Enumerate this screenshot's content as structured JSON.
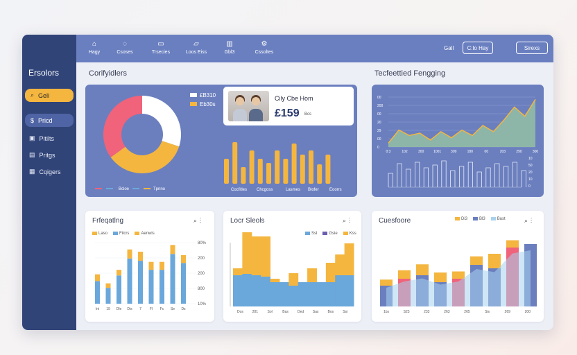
{
  "colors": {
    "navy": "#314478",
    "periwinkle": "#6b7fbf",
    "yellow": "#f4b63f",
    "blue": "#6aa7db",
    "pink": "#f0637a",
    "white": "#ffffff"
  },
  "sidebar": {
    "brand": "Ersolors",
    "primary_button": {
      "label": "Geli",
      "icon": "search-icon"
    },
    "items": [
      {
        "label": "Pricd",
        "icon": "dollar-icon",
        "active": true
      },
      {
        "label": "Pitilts",
        "icon": "box-icon"
      },
      {
        "label": "Pritgs",
        "icon": "tag-icon"
      },
      {
        "label": "Cqigers",
        "icon": "grid-icon"
      }
    ]
  },
  "topbar": {
    "nav": [
      {
        "label": "Hagy",
        "icon": "home-icon"
      },
      {
        "label": "Csoses",
        "icon": "user-icon"
      },
      {
        "label": "Trsecies",
        "icon": "doc-icon"
      },
      {
        "label": "Loos Eiss",
        "icon": "folder-icon"
      },
      {
        "label": "Gbl3",
        "icon": "chart-icon"
      },
      {
        "label": "Cssoltes",
        "icon": "settings-icon"
      }
    ],
    "right_text": "Gall",
    "button1": "C:lo Hay",
    "button2": "Sirexs",
    "icon_right": "chevron-up-icon"
  },
  "section1_title": "Corifyidlers",
  "section2_title": "Tecfeettied Fengging",
  "donut_panel": {
    "legend": [
      {
        "label": "£B310",
        "color": "#ffffff"
      },
      {
        "label": "Eb30s",
        "color": "#f4b63f"
      }
    ],
    "bottom_legend": [
      "Bcloe",
      "Tpnno"
    ]
  },
  "profile": {
    "name": "Cily Cbe Hom",
    "amount": "£159",
    "unit": "Bcs"
  },
  "bars_labels": [
    "Cocfitles",
    "Chcgoss",
    "Lasmes",
    "Blofer",
    "Eoorrs"
  ],
  "card1": {
    "title": "Frfeqatlng",
    "legend": [
      {
        "label": "Laso",
        "color": "#f4b63f"
      },
      {
        "label": "Filcrs",
        "color": "#6aa7db"
      },
      {
        "label": "Aenwis",
        "color": "#f4b63f"
      }
    ],
    "y_labels": [
      "80%",
      "200",
      "200",
      "800",
      "10%"
    ],
    "x_labels": [
      "Ini",
      "19",
      "Dle",
      "Dis",
      "7",
      "Fl",
      "Fc",
      "Se",
      "Ds"
    ]
  },
  "card2": {
    "title": "Locr Sleols",
    "legend": [
      {
        "label": "Ssl",
        "color": "#6aa7db"
      },
      {
        "label": "Gsie",
        "color": "#6b5fb0"
      },
      {
        "label": "Kss",
        "color": "#f4b63f"
      }
    ],
    "x_labels": [
      "Dos",
      "201",
      "Sol",
      "Bas",
      "Ded",
      "Sas",
      "Bos",
      "Ssi"
    ]
  },
  "card3": {
    "title": "Cuesfoore",
    "legend": [
      {
        "label": "Di3",
        "color": "#f4b63f"
      },
      {
        "label": "Bl3",
        "color": "#6b7fbf"
      },
      {
        "label": "Bust",
        "color": "#a8d2ee"
      }
    ],
    "x_labels": [
      "1bs",
      "S23",
      "233",
      "263",
      "265",
      "Sis",
      "269",
      "200"
    ]
  },
  "chart_data": [
    {
      "type": "pie",
      "title": "",
      "labels": [
        "£B310",
        "Eb30s"
      ],
      "values": [
        30,
        35,
        35
      ],
      "colors": [
        "#ffffff",
        "#f4b63f",
        "#f0637a"
      ]
    },
    {
      "type": "bar",
      "title": "",
      "values": [
        36,
        60,
        24,
        48,
        36,
        30,
        48,
        36,
        58,
        42,
        48,
        28,
        42
      ],
      "color": "#f4b63f"
    },
    {
      "type": "area",
      "title": "Tecfeettied Fengging",
      "y_tick_labels": [
        "00",
        "200",
        "00",
        "20",
        "29",
        "00",
        "0"
      ],
      "x_tick_labels": [
        "0:3",
        "102",
        "300",
        "1001",
        "309",
        "180",
        "00",
        "203",
        "290",
        "300"
      ],
      "values": [
        5,
        22,
        15,
        18,
        9,
        20,
        12,
        22,
        15,
        28,
        20,
        35,
        52,
        40,
        62
      ]
    },
    {
      "type": "line",
      "title": "",
      "y_tick_labels": [
        "10",
        "50",
        "20",
        "10",
        "0"
      ],
      "values": [
        20,
        34,
        26,
        36,
        28,
        32,
        38,
        24,
        30,
        36,
        22,
        28,
        34,
        30,
        36,
        24
      ]
    },
    {
      "type": "bar",
      "title": "Frfeqatlng",
      "series": [
        {
          "name": "Filcrs",
          "values": [
            20,
            14,
            25,
            40,
            38,
            30,
            30,
            44,
            36
          ]
        },
        {
          "name": "Laso",
          "values": [
            6,
            4,
            5,
            8,
            8,
            7,
            7,
            8,
            7
          ]
        }
      ],
      "categories": [
        "Ini",
        "19",
        "Dle",
        "Dis",
        "7",
        "Fl",
        "Fc",
        "Se",
        "Ds"
      ]
    },
    {
      "type": "bar",
      "title": "Locr Sleols",
      "series": [
        {
          "name": "Ssl",
          "values": [
            45,
            47,
            45,
            43,
            35,
            35,
            30,
            35,
            35,
            35,
            35,
            45,
            45
          ]
        },
        {
          "name": "Kss",
          "values": [
            10,
            60,
            56,
            58,
            5,
            0,
            18,
            0,
            20,
            0,
            28,
            30,
            46
          ]
        }
      ],
      "categories": [
        "Dos",
        "201",
        "Sol",
        "Bas",
        "Ded",
        "Sas",
        "Bos",
        "Ssi"
      ]
    },
    {
      "type": "bar",
      "title": "Cuesfoore",
      "series": [
        {
          "name": "Bl3",
          "values": [
            30,
            40,
            45,
            35,
            40,
            60,
            55,
            85,
            90
          ]
        },
        {
          "name": "Di3",
          "values": [
            25,
            35,
            45,
            40,
            30,
            35,
            60,
            30,
            80
          ]
        }
      ],
      "categories": [
        "1bs",
        "S23",
        "233",
        "263",
        "265",
        "Sis",
        "269",
        "200"
      ]
    }
  ]
}
